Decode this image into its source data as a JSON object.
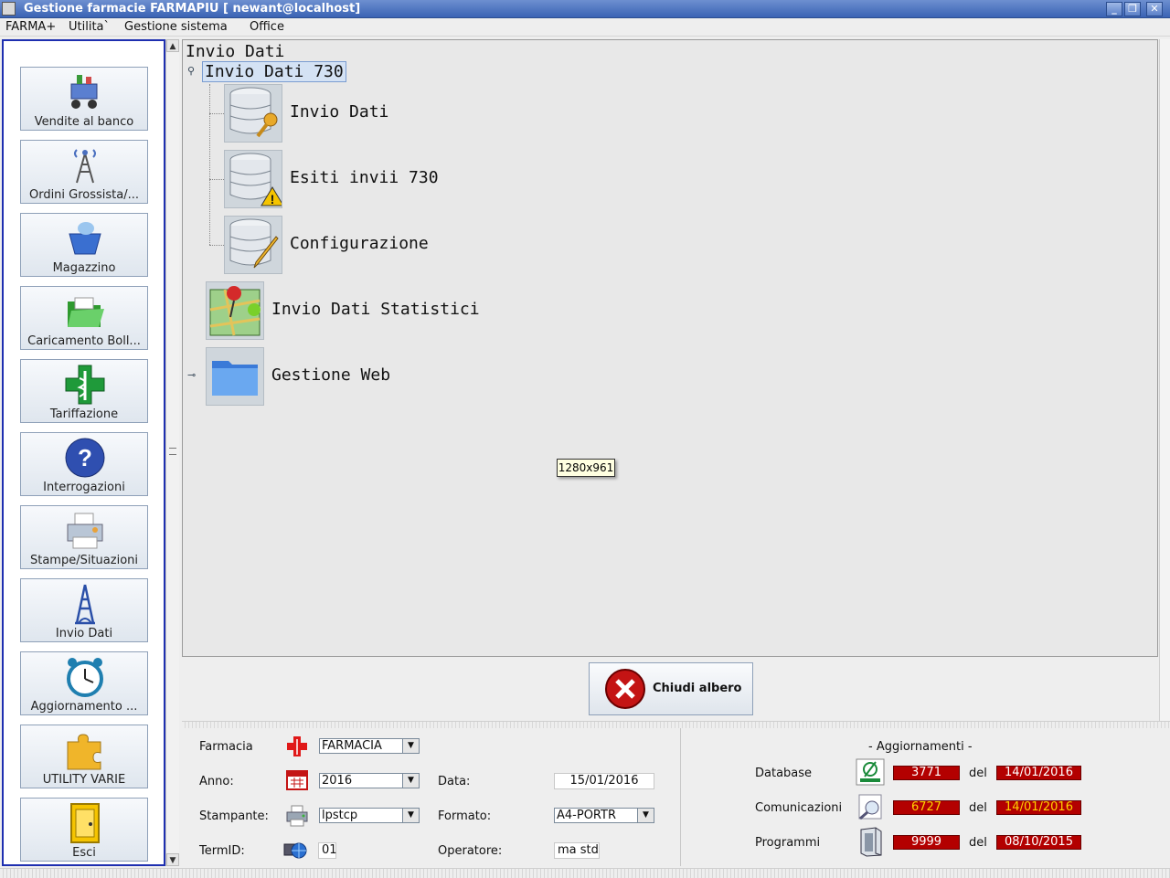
{
  "window": {
    "title": "Gestione farmacie FARMAPIU [ newant@localhost]"
  },
  "menu": [
    "FARMA+",
    "Utilita`",
    "Gestione sistema",
    "Office"
  ],
  "sidebar": {
    "items": [
      {
        "label": "Vendite al banco",
        "icon": "shopping-cart-icon"
      },
      {
        "label": "Ordini Grossista/...",
        "icon": "antenna-tower-icon"
      },
      {
        "label": "Magazzino",
        "icon": "basket-icon"
      },
      {
        "label": "Caricamento Boll...",
        "icon": "open-folder-icon"
      },
      {
        "label": "Tariffazione",
        "icon": "pharmacy-cross-icon"
      },
      {
        "label": "Interrogazioni",
        "icon": "question-icon"
      },
      {
        "label": "Stampe/Situazioni",
        "icon": "printer-icon"
      },
      {
        "label": "Invio Dati",
        "icon": "eiffel-tower-icon"
      },
      {
        "label": "Aggiornamento ...",
        "icon": "alarm-clock-icon"
      },
      {
        "label": "UTILITY VARIE",
        "icon": "puzzle-icon"
      },
      {
        "label": "Esci",
        "icon": "exit-door-icon"
      }
    ]
  },
  "tree": {
    "root": "Invio Dati",
    "selected_node": "Invio Dati 730",
    "children_730": [
      {
        "label": "Invio Dati",
        "icon": "database-key-icon"
      },
      {
        "label": "Esiti invii 730",
        "icon": "database-warning-icon"
      },
      {
        "label": "Configurazione",
        "icon": "database-edit-icon"
      }
    ],
    "other_nodes": [
      {
        "label": "Invio Dati Statistici",
        "icon": "map-pins-icon"
      },
      {
        "label": "Gestione Web",
        "icon": "folder-icon"
      }
    ]
  },
  "tooltip": "1280x961",
  "close_button": {
    "label": "Chiudi albero",
    "icon": "close-circle-icon"
  },
  "info": {
    "farmacia_label": "Farmacia",
    "farmacia_value": "FARMACIA",
    "anno_label": "Anno:",
    "anno_value": "2016",
    "data_label": "Data:",
    "data_value": "15/01/2016",
    "stampante_label": "Stampante:",
    "stampante_value": "lpstcp",
    "formato_label": "Formato:",
    "formato_value": "A4-PORTR",
    "termid_label": "TermID:",
    "termid_value": "01",
    "operatore_label": "Operatore:",
    "operatore_value": "ma std"
  },
  "updates": {
    "title": "- Aggiornamenti -",
    "del_label": "del",
    "rows": [
      {
        "label": "Database",
        "number": "3771",
        "date": "14/01/2016"
      },
      {
        "label": "Comunicazioni",
        "number": "6727",
        "date": "14/01/2016"
      },
      {
        "label": "Programmi",
        "number": "9999",
        "date": "08/10/2015"
      }
    ]
  },
  "colors": {
    "accent_blue": "#1e2fb0",
    "update_red": "#b30000",
    "highlight_yellow": "#ffd200"
  }
}
